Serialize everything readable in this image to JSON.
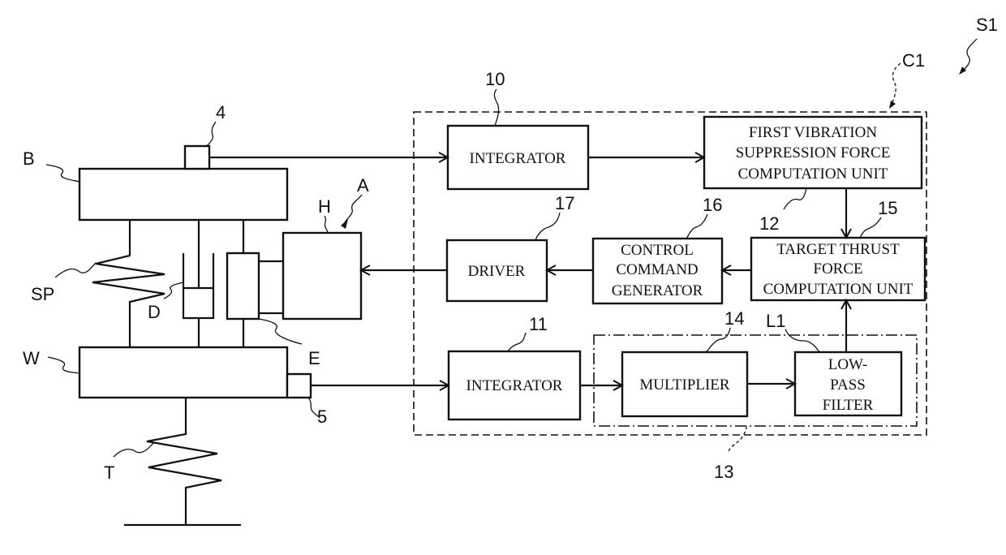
{
  "figure": {
    "system_label": "S1",
    "controller_label": "C1",
    "actuator_label": "A"
  },
  "mechanical": {
    "sprung_mass": "B",
    "unsprung_mass": "W",
    "suspension_spring": "SP",
    "tire": "T",
    "damper": "D",
    "actuator_body": "E",
    "motor": "H",
    "sprung_sensor": "4",
    "unsprung_sensor": "5"
  },
  "blocks": {
    "integrator_10": {
      "ref": "10",
      "lines": [
        "INTEGRATOR"
      ]
    },
    "integrator_11": {
      "ref": "11",
      "lines": [
        "INTEGRATOR"
      ]
    },
    "first_vibration": {
      "ref": "12",
      "lines": [
        "FIRST VIBRATION",
        "SUPPRESSION FORCE",
        "COMPUTATION UNIT"
      ]
    },
    "multiplier": {
      "ref": "14",
      "lines": [
        "MULTIPLIER"
      ]
    },
    "low_pass": {
      "ref": "L1",
      "lines": [
        "LOW-",
        "PASS",
        "FILTER"
      ]
    },
    "target_thrust": {
      "ref": "15",
      "lines": [
        "TARGET THRUST",
        "FORCE",
        "COMPUTATION UNIT"
      ]
    },
    "control_command": {
      "ref": "16",
      "lines": [
        "CONTROL",
        "COMMAND",
        "GENERATOR"
      ]
    },
    "driver": {
      "ref": "17",
      "lines": [
        "DRIVER"
      ]
    }
  },
  "groups": {
    "second_unit_ref": "13"
  }
}
